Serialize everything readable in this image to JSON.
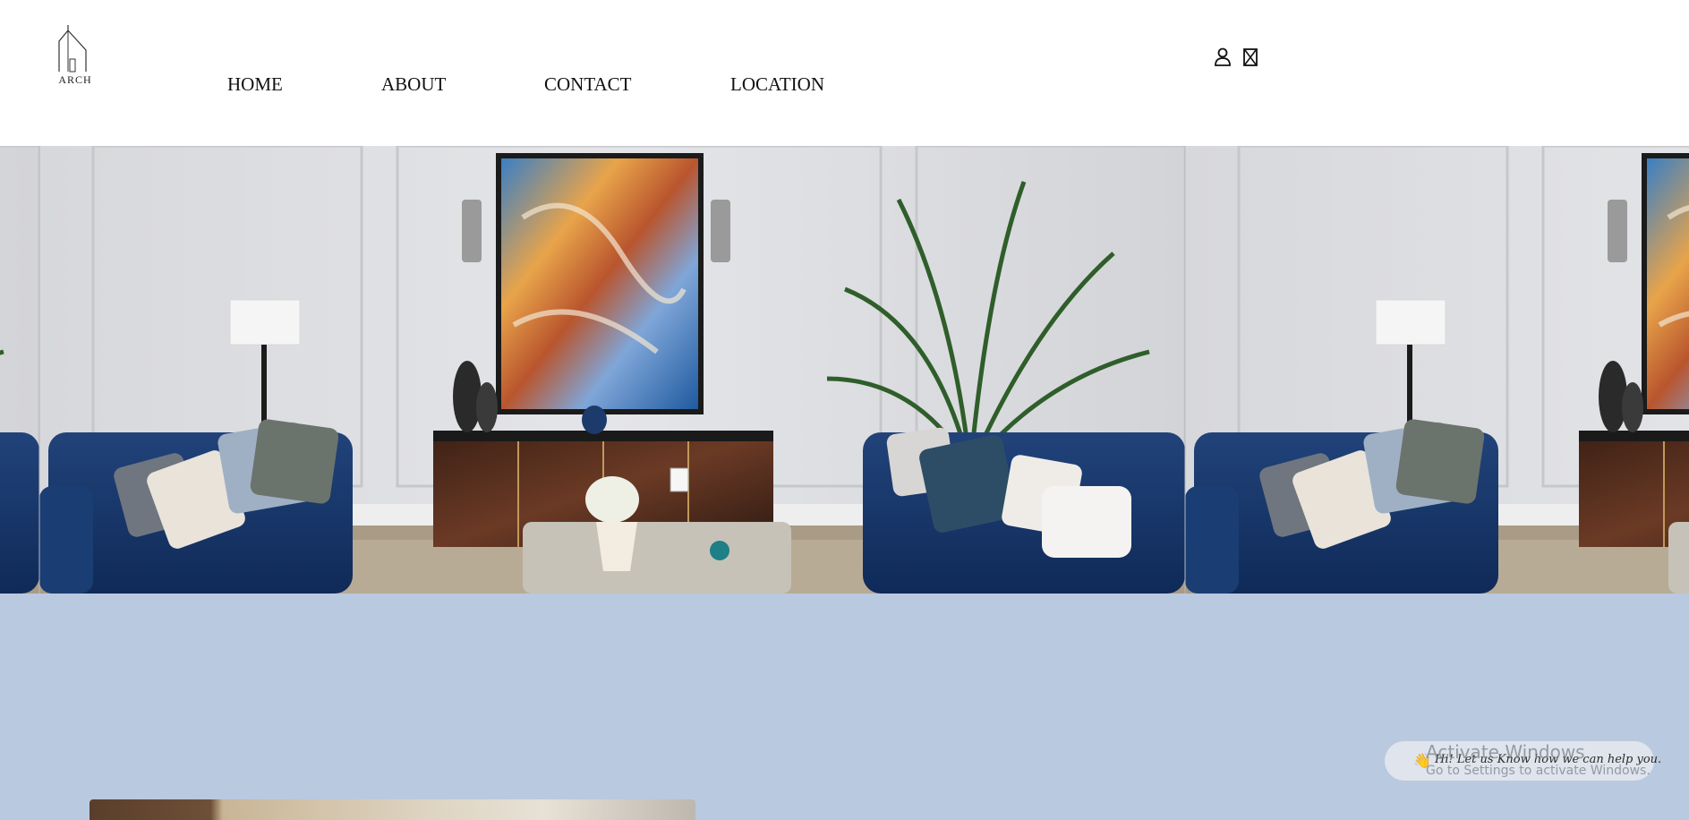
{
  "logo": {
    "text": "ARCH"
  },
  "nav": {
    "home": "HOME",
    "about": "ABOUT",
    "contact": "CONTACT",
    "location": "LOCATION"
  },
  "header_icons": [
    "user-icon",
    "cart-icon"
  ],
  "hero": {
    "image": "living room with blue velvet sofas, abstract painting, palm plant, dark wood sideboard"
  },
  "section": {
    "background": "#b9c9e0"
  },
  "chat": {
    "emoji": "👋",
    "text": "Hi! Let us Know how we can help you."
  },
  "watermark": {
    "title": "Activate Windows",
    "subtitle": "Go to Settings to activate Windows."
  }
}
